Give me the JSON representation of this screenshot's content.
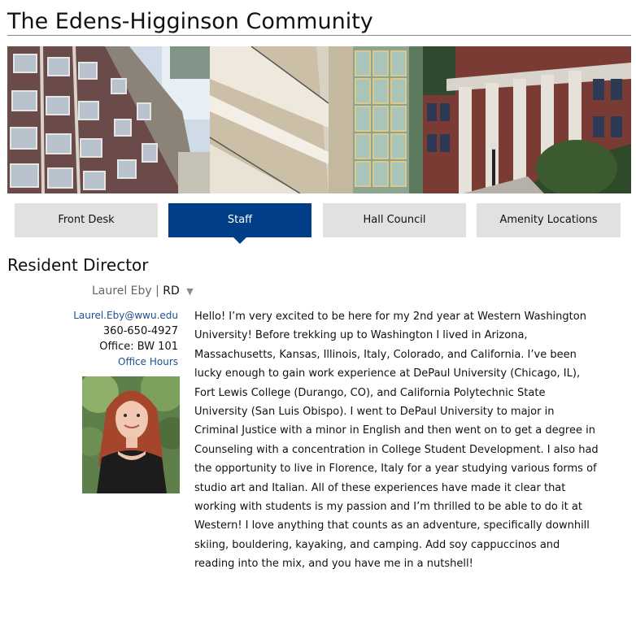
{
  "site": {
    "title": "The Edens-Higginson Community"
  },
  "nav": {
    "tabs": [
      {
        "label": "Front Desk",
        "active": false
      },
      {
        "label": "Staff",
        "active": true
      },
      {
        "label": "Hall Council",
        "active": false
      },
      {
        "label": "Amenity Locations",
        "active": false
      }
    ]
  },
  "section": {
    "heading": "Resident Director"
  },
  "staff": {
    "name": "Laurel Eby",
    "separator": "|",
    "role": "RD",
    "dropdown_icon": "triangle-down-icon",
    "email": "Laurel.Eby@wwu.edu",
    "phone": "360-650-4927",
    "office": "Office: BW 101",
    "office_hours_link": "Office Hours",
    "bio": "Hello! I’m very excited to be here for my 2nd year at Western Washington University! Before trekking up to Washington I lived in Arizona, Massachusetts, Kansas, Illinois, Italy, Colorado, and California. I’ve been lucky enough to gain work experience at DePaul University (Chicago, IL), Fort Lewis College (Durango, CO), and California Polytechnic State University (San Luis Obispo). I went to DePaul University to major in Criminal Justice with a minor in English and then went on to get a degree in Counseling with a concentration in College Student Development. I also had the opportunity to live in Florence, Italy for a year studying various forms of studio art and Italian. All of these experiences have made it clear that working with students is my passion and I’m thrilled to be able to do it at Western! I love anything that counts as an adventure, specifically downhill skiing, bouldering, kayaking, and camping. Add soy cappuccinos and reading into the mix, and you have me in a nutshell!"
  },
  "colors": {
    "nav_active": "#003f87",
    "nav_inactive": "#e1e1e1",
    "link": "#1d4f91"
  }
}
